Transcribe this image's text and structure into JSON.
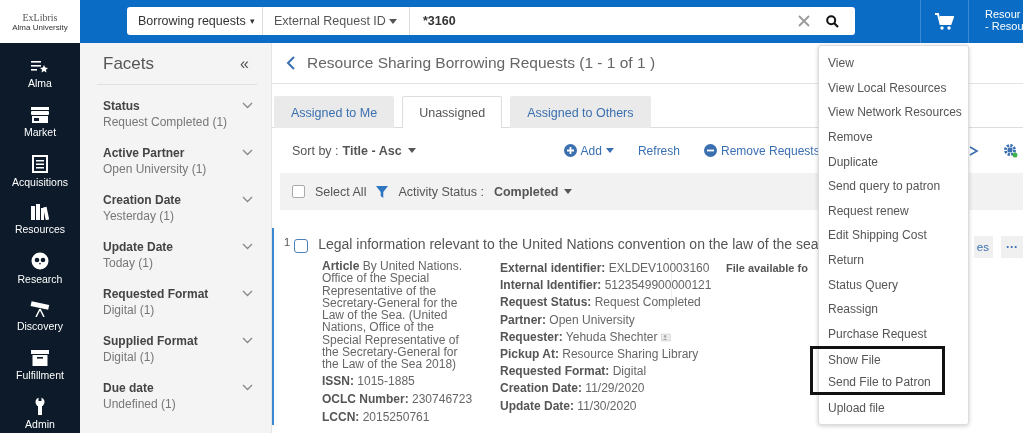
{
  "header": {
    "logo": {
      "brand": "ExLibris",
      "institution": "Alma University"
    },
    "search": {
      "scope": "Borrowing requests",
      "scope_caret": "▾",
      "field": "External Request ID",
      "value": "*3160"
    },
    "user": [
      "Resour",
      "- Resou"
    ]
  },
  "nav": [
    {
      "label": "Alma"
    },
    {
      "label": "Market"
    },
    {
      "label": "Acquisitions"
    },
    {
      "label": "Resources"
    },
    {
      "label": "Research"
    },
    {
      "label": "Discovery"
    },
    {
      "label": "Fulfillment"
    },
    {
      "label": "Admin"
    }
  ],
  "facets": {
    "title": "Facets",
    "collapse": "«",
    "groups": [
      {
        "name": "Status",
        "value": "Request Completed (1)"
      },
      {
        "name": "Active Partner",
        "value": "Open University (1)"
      },
      {
        "name": "Creation Date",
        "value": "Yesterday (1)"
      },
      {
        "name": "Update Date",
        "value": "Today (1)"
      },
      {
        "name": "Requested Format",
        "value": "Digital (1)"
      },
      {
        "name": "Supplied Format",
        "value": "Digital (1)"
      },
      {
        "name": "Due date",
        "value": "Undefined (1)"
      }
    ]
  },
  "page_title": "Resource Sharing Borrowing Requests (1 - 1 of 1 )",
  "tabs": [
    {
      "label": "Assigned to Me",
      "selected": false
    },
    {
      "label": "Unassigned",
      "selected": true
    },
    {
      "label": "Assigned to Others",
      "selected": false
    }
  ],
  "toolbar": {
    "sort_label": "Sort by :",
    "sort_value": "Title - Asc",
    "add": "Add",
    "refresh": "Refresh",
    "remove": "Remove Requests"
  },
  "filter_bar": {
    "select_all": "Select All",
    "checked": false,
    "filter_label": "Activity Status :",
    "filter_value": "Completed"
  },
  "record": {
    "number": "1",
    "checked": false,
    "title": "Legal information relevant to the United Nations convention on the law of the sea",
    "description": "**Article** By United Nations. Office of the Special Representative of the Secretary-General for the Law of the Sea. (United Nations, Office of the Special Representative of the Secretary-General for the Law of the Sea 2018)",
    "identifiers": [
      "**ISSN:** 1015-1885",
      "**OCLC Number:** 230746723",
      "**LCCN:** 2015250761"
    ],
    "fields": [
      {
        "label": "External identifier:",
        "value": "EXLDEV10003160"
      },
      {
        "label": "Internal Identifier:",
        "value": "5123549900000121"
      },
      {
        "label": "Request Status:",
        "value": "Request Completed"
      },
      {
        "label": "Partner:",
        "value": "Open University"
      },
      {
        "label": "Requester:",
        "value": "Yehuda Shechter"
      },
      {
        "label": "Pickup At:",
        "value": "Resource Sharing Library"
      },
      {
        "label": "Requested Format:",
        "value": "Digital"
      },
      {
        "label": "Creation Date:",
        "value": "11/29/2020"
      },
      {
        "label": "Update Date:",
        "value": "11/30/2020"
      }
    ],
    "file_note": "File available fo",
    "action_partial": "es",
    "more": "···"
  },
  "menu": [
    {
      "label": "View",
      "highlighted": false
    },
    {
      "label": "View Local Resources",
      "highlighted": false
    },
    {
      "label": "View Network Resources",
      "highlighted": false
    },
    {
      "label": "Remove",
      "highlighted": false
    },
    {
      "label": "Duplicate",
      "highlighted": false
    },
    {
      "label": "Send query to patron",
      "highlighted": false
    },
    {
      "label": "Request renew",
      "highlighted": false
    },
    {
      "label": "Edit Shipping Cost",
      "highlighted": false
    },
    {
      "label": "Return",
      "highlighted": false
    },
    {
      "label": "Status Query",
      "highlighted": false
    },
    {
      "label": "Reassign",
      "highlighted": false
    },
    {
      "label": "Purchase Request",
      "highlighted": false
    },
    {
      "label": "Show File",
      "highlighted": true
    },
    {
      "label": "Send File to Patron",
      "highlighted": true
    },
    {
      "label": "Upload file",
      "highlighted": false
    }
  ]
}
